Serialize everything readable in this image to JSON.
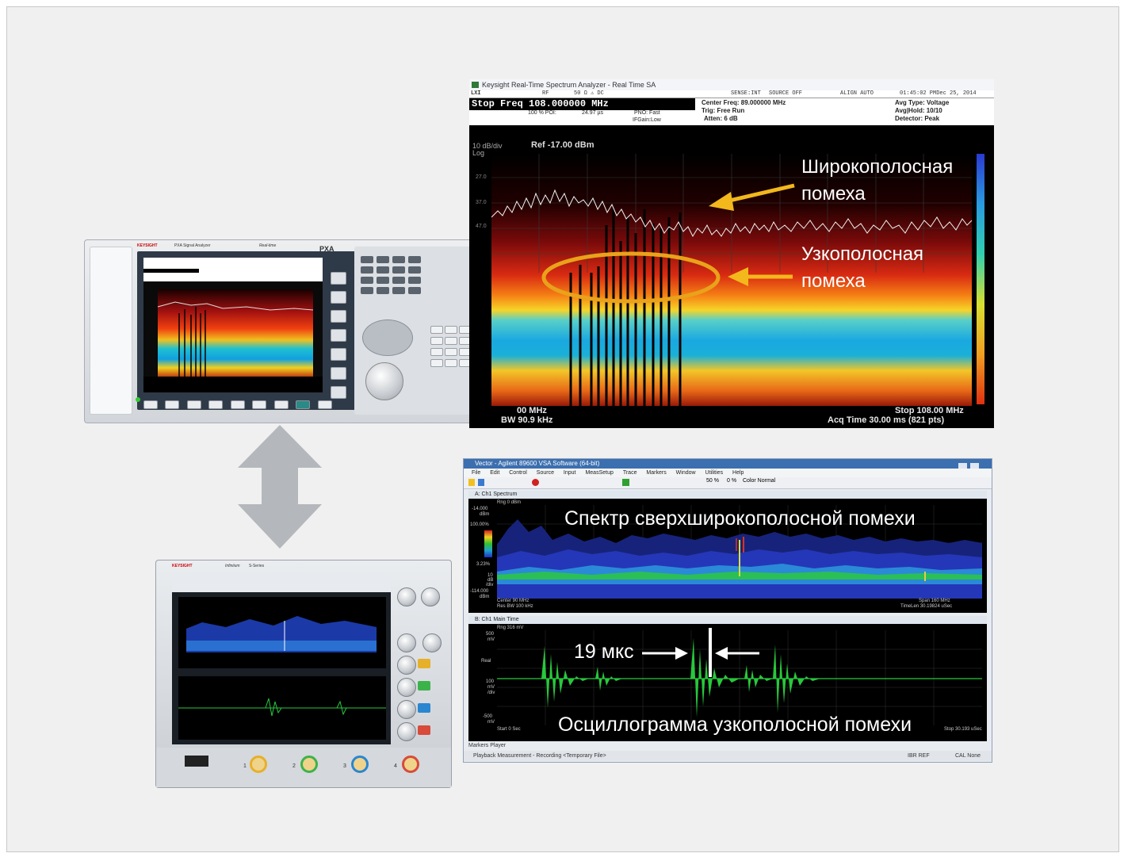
{
  "pxa_device": {
    "brand": "KEYSIGHT",
    "model": "PXA",
    "subtitle": "PXA Signal Analyzer",
    "mode": "Real-time"
  },
  "rtsa": {
    "window_title": "Keysight Real-Time Spectrum Analyzer - Real Time SA",
    "status_bar": {
      "lxi": "LXI",
      "input": "RF",
      "impedance": "50 Ω  ⚠  DC",
      "sense": "SENSE:INT",
      "source": "SOURCE OFF",
      "align": "ALIGN AUTO",
      "datetime": "01:45:02 PMDec 25, 2014"
    },
    "stop_freq_entry": "Stop Freq 108.000000 MHz",
    "pdi": "100 % POI:",
    "pdi_value": "24.97 µs",
    "pno": "PNO: Fast",
    "ifgain": "IFGain:Low",
    "center_freq": "Center Freq: 89.000000 MHz",
    "trig": "Trig: Free Run",
    "atten": "Atten: 6 dB",
    "avg_type": "Avg Type: Voltage",
    "avg_hold": "Avg|Hold: 10/10",
    "detector": "Detector: Peak",
    "scale": "10 dB/div",
    "log": "Log",
    "ref": "Ref -17.00 dBm",
    "y_ticks": [
      "27.0",
      "37.0",
      "47.0"
    ],
    "start_label": "00 MHz",
    "rbw_label": "BW 90.9 kHz",
    "stop_label": "Stop 108.00 MHz",
    "acq_label": "Acq Time  30.00 ms (821 pts)"
  },
  "annotations": {
    "wideband_line1": "Широкополосная",
    "wideband_line2": "помеха",
    "narrowband_line1": "Узкополосная",
    "narrowband_line2": "помеха",
    "uwb_spectrum": "Спектр сверхширокополосной помехи",
    "pulse_spacing": "19 мкс",
    "narrowband_waveform": "Осциллограмма узкополосной помехи"
  },
  "vsa": {
    "window_title": "Vector - Agilent 89600 VSA Software (64-bit)",
    "menu": [
      "File",
      "Edit",
      "Control",
      "Source",
      "Input",
      "MeasSetup",
      "Trace",
      "Markers",
      "Window",
      "Utilities",
      "Help"
    ],
    "toolbar_zoom": "50 %",
    "toolbar_pct": "0 %",
    "toolbar_color": "Color Normal",
    "spectrum_pane": {
      "tab": "A: Ch1 Spectrum",
      "ref": "Rng 0 dBm",
      "top_val": "-14.000",
      "top_unit": "dBm",
      "pct_hi": "100.00%",
      "pct_lo": "3.23%",
      "div": "10",
      "div_unit": "dB",
      "div_unit2": "/div",
      "bottom_val": "-114.000",
      "bottom_unit": "dBm",
      "center": "Center 90 MHz",
      "rbw": "Res BW 100 kHz",
      "span": "Span 160 MHz",
      "timelen": "TimeLen 30.19824 uSec"
    },
    "time_pane": {
      "tab": "B: Ch1 Main Time",
      "ref": "Rng 316 mV",
      "top_val": "500",
      "top_unit": "mV",
      "real": "Real",
      "mid_val": "100",
      "mid_unit": "mV",
      "mid_div": "/div",
      "bottom_val": "-500",
      "bottom_unit": "mV",
      "start": "Start 0  Sec",
      "stop": "Stop 30.193 uSec"
    },
    "bottom_tabs": "Markers  Player",
    "status_left": "Playback Measurement - Recording <Temporary File>",
    "status_mid": "IBR REF",
    "status_right": "CAL None"
  },
  "scope_device": {
    "brand": "KEYSIGHT",
    "model": "Infiniium",
    "series": "S-Series",
    "channels": [
      "1",
      "2",
      "3",
      "4"
    ]
  },
  "colors": {
    "annotation_arrow": "#f2b81c",
    "ellipse": "#e9a21a",
    "double_arrow": "#b4b7bb",
    "waveform_green": "#28c83c"
  }
}
